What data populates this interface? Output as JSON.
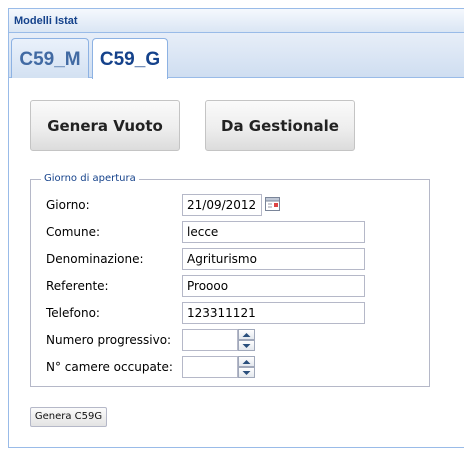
{
  "window": {
    "title": "Modelli Istat"
  },
  "tabs": [
    {
      "label": "C59_M",
      "active": false
    },
    {
      "label": "C59_G",
      "active": true
    }
  ],
  "actions": {
    "empty_label": "Genera Vuoto",
    "from_management_label": "Da Gestionale"
  },
  "form": {
    "legend": "Giorno di apertura",
    "giorno": {
      "label": "Giorno:",
      "value": "21/09/2012"
    },
    "comune": {
      "label": "Comune:",
      "value": "lecce"
    },
    "denominazione": {
      "label": "Denominazione:",
      "value": "Agriturismo"
    },
    "referente": {
      "label": "Referente:",
      "value": "Proooo"
    },
    "telefono": {
      "label": "Telefono:",
      "value": "123311121"
    },
    "numero_progressivo": {
      "label": "Numero progressivo:",
      "value": ""
    },
    "camere_occupate": {
      "label": "N° camere occupate:",
      "value": ""
    }
  },
  "footer": {
    "generate_label": "Genera C59G"
  },
  "colors": {
    "header_text": "#15428b",
    "border": "#99bbe8",
    "tab_text": "#416aa3"
  },
  "icons": {
    "calendar": "calendar-icon",
    "spinner_up": "spin-up-icon",
    "spinner_down": "spin-down-icon"
  }
}
